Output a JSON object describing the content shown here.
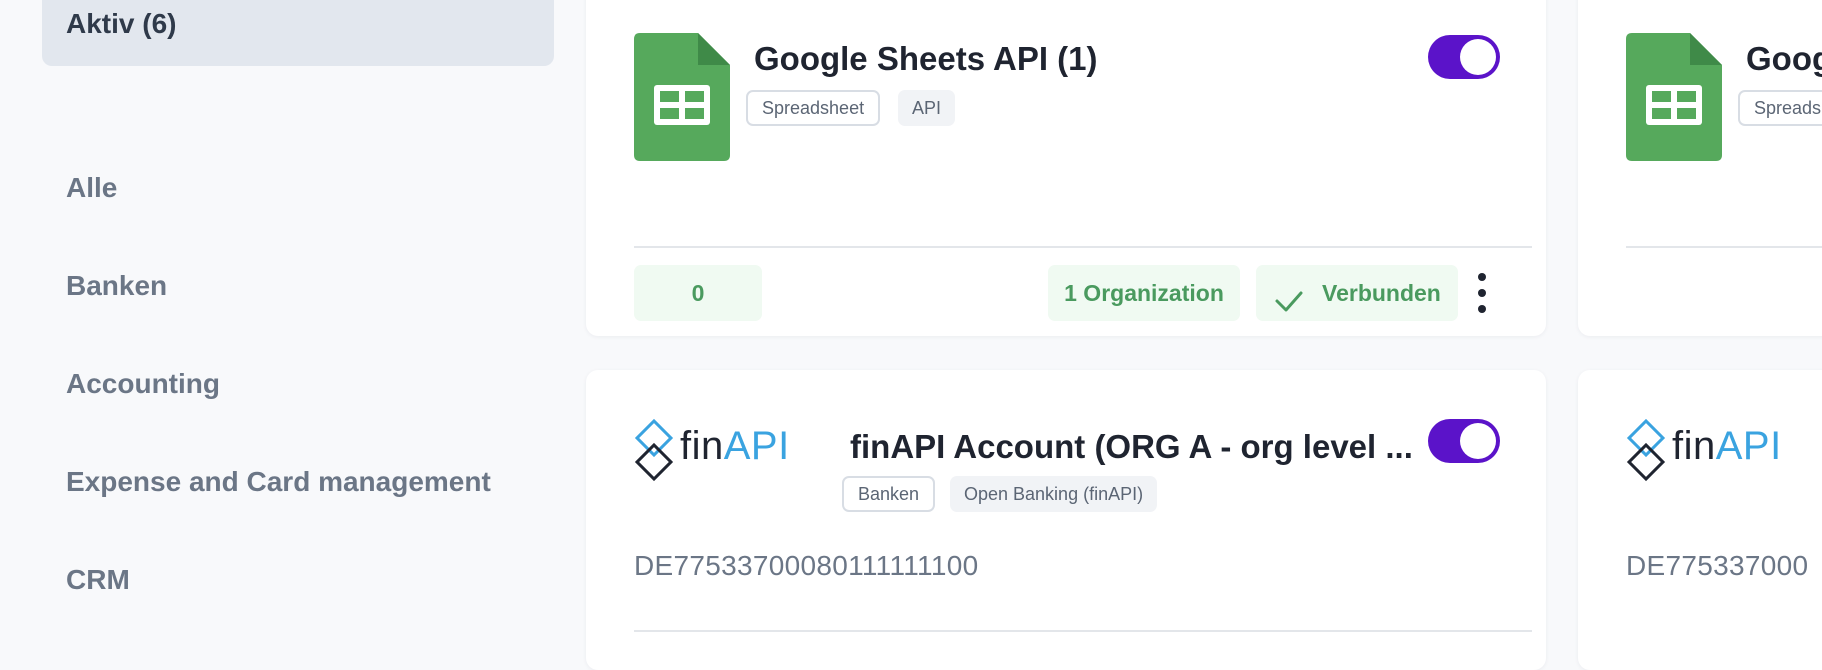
{
  "sidebar": {
    "active": "Aktiv (6)",
    "items": [
      {
        "label": "Alle"
      },
      {
        "label": "Banken"
      },
      {
        "label": "Accounting"
      },
      {
        "label": "Expense and Card management"
      },
      {
        "label": "CRM"
      }
    ]
  },
  "cards": {
    "sheets_main": {
      "title": "Google Sheets API (1)",
      "tags": [
        "Spreadsheet",
        "API"
      ],
      "toggle_on": true,
      "count": "0",
      "organizations": "1 Organization",
      "status": "Verbunden",
      "icons": {
        "logo": "google-sheets-icon",
        "check": "check-icon",
        "menu": "more-vertical-icon"
      }
    },
    "sheets_partial": {
      "title": "Goog",
      "tags": [
        "Spreads"
      ]
    },
    "finapi_main": {
      "logo_fin": "fin",
      "logo_api": "API",
      "title": "finAPI Account (ORG A - org level ...",
      "tags": [
        "Banken",
        "Open Banking (finAPI)"
      ],
      "toggle_on": true,
      "iban": "DE77533700080111111100"
    },
    "finapi_partial": {
      "logo_fin": "fin",
      "logo_api": "API",
      "iban": "DE775337000"
    }
  },
  "colors": {
    "accent_toggle": "#5b13c9",
    "success_green": "#4a9a5f",
    "success_bg": "#f0faf2",
    "sheets_green": "#56a95c",
    "finapi_blue": "#3aa3e0"
  }
}
